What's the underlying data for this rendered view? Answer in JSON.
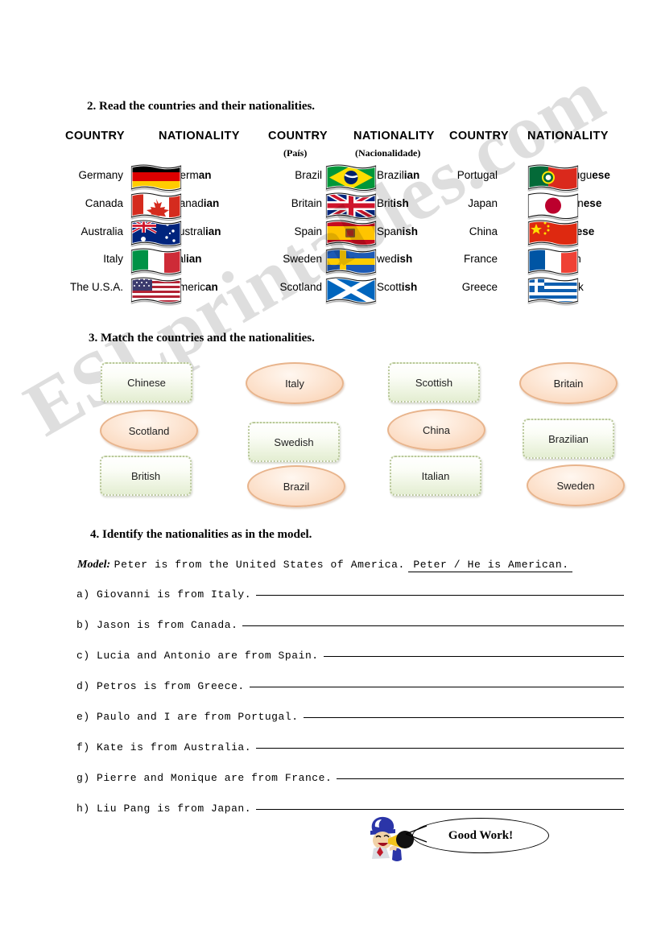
{
  "headings": {
    "s2": "2.  Read the countries and their nationalities.",
    "s3": "3. Match the countries and the nationalities.",
    "s4": "4. Identify the  nationalities as in the model."
  },
  "watermark": "ESLprintables.com",
  "table": {
    "col_headers": [
      "COUNTRY",
      "NATIONALITY",
      "COUNTRY",
      "NATIONALITY",
      "COUNTRY",
      "NATIONALITY"
    ],
    "sub_labels": {
      "country": "(País)",
      "nationality": "(Nacionalidade)"
    },
    "groups": [
      {
        "rows": [
          {
            "country": "Germany",
            "nat_stem": "Germ",
            "nat_suffix": "an",
            "flag": "germany-flag"
          },
          {
            "country": "Canada",
            "nat_stem": "Canad",
            "nat_suffix": "ian",
            "flag": "canada-flag"
          },
          {
            "country": "Australia",
            "nat_stem": "Austral",
            "nat_suffix": "ian",
            "flag": "australia-flag"
          },
          {
            "country": "Italy",
            "nat_stem": "Ital",
            "nat_suffix": "ian",
            "flag": "italy-flag"
          },
          {
            "country": "The U.S.A.",
            "nat_stem": "Americ",
            "nat_suffix": "an",
            "flag": "usa-flag"
          }
        ]
      },
      {
        "rows": [
          {
            "country": "Brazil",
            "nat_stem": "Brazil",
            "nat_suffix": "ian",
            "flag": "brazil-flag"
          },
          {
            "country": "Britain",
            "nat_stem": "Brit",
            "nat_suffix": "ish",
            "flag": "britain-flag"
          },
          {
            "country": "Spain",
            "nat_stem": "Span",
            "nat_suffix": "ish",
            "flag": "spain-flag"
          },
          {
            "country": "Sweden",
            "nat_stem": "wed",
            "nat_suffix": "ish",
            "flag": "sweden-flag"
          },
          {
            "country": "Scotland",
            "nat_stem": "Scott",
            "nat_suffix": "ish",
            "flag": "scotland-flag"
          }
        ]
      },
      {
        "rows": [
          {
            "country": "Portugal",
            "nat_stem": "Portugu",
            "nat_suffix": "ese",
            "flag": "portugal-flag"
          },
          {
            "country": "Japan",
            "nat_stem": "Japan",
            "nat_suffix": "ese",
            "flag": "japan-flag"
          },
          {
            "country": "China",
            "nat_stem": "Chin",
            "nat_suffix": "ese",
            "flag": "china-flag"
          },
          {
            "country": "France",
            "nat_stem": "rench",
            "nat_suffix": "",
            "flag": "france-flag"
          },
          {
            "country": "Greece",
            "nat_stem": "Greek",
            "nat_suffix": "",
            "flag": "greece-flag"
          }
        ]
      }
    ]
  },
  "match": {
    "items": [
      {
        "label": "Chinese",
        "shape": "rect"
      },
      {
        "label": "Scotland",
        "shape": "oval"
      },
      {
        "label": "British",
        "shape": "rect"
      },
      {
        "label": "Italy",
        "shape": "oval"
      },
      {
        "label": "Swedish",
        "shape": "rect"
      },
      {
        "label": "Brazil",
        "shape": "oval"
      },
      {
        "label": "Scottish",
        "shape": "rect"
      },
      {
        "label": "China",
        "shape": "oval"
      },
      {
        "label": "Italian",
        "shape": "rect"
      },
      {
        "label": "Britain",
        "shape": "oval"
      },
      {
        "label": "Brazilian",
        "shape": "rect"
      },
      {
        "label": "Sweden",
        "shape": "oval"
      }
    ]
  },
  "model": {
    "label": "Model:",
    "prompt": "Peter is from the United States of America.",
    "answer": "Peter / He  is American."
  },
  "questions": [
    {
      "marker": "a)",
      "text": "Giovanni is from Italy."
    },
    {
      "marker": "b)",
      "text": "Jason is  from Canada."
    },
    {
      "marker": "c)",
      "text": "Lucia and Antonio are from  Spain."
    },
    {
      "marker": "d)",
      "text": "Petros is from Greece."
    },
    {
      "marker": "e)",
      "text": "Paulo and I are  from Portugal."
    },
    {
      "marker": "f)",
      "text": "Kate is  from Australia."
    },
    {
      "marker": "g)",
      "text": "Pierre and Monique are  from France."
    },
    {
      "marker": "h)",
      "text": "Liu Pang is  from Japan."
    }
  ],
  "footer": {
    "good_work": "Good Work!"
  },
  "colors": {
    "rect_fill": "#e4eed2",
    "rect_border": "#b9c79a",
    "oval_fill": "#f9cfae",
    "oval_border": "#e8b48c",
    "watermark": "rgba(0,0,0,0.13)"
  }
}
